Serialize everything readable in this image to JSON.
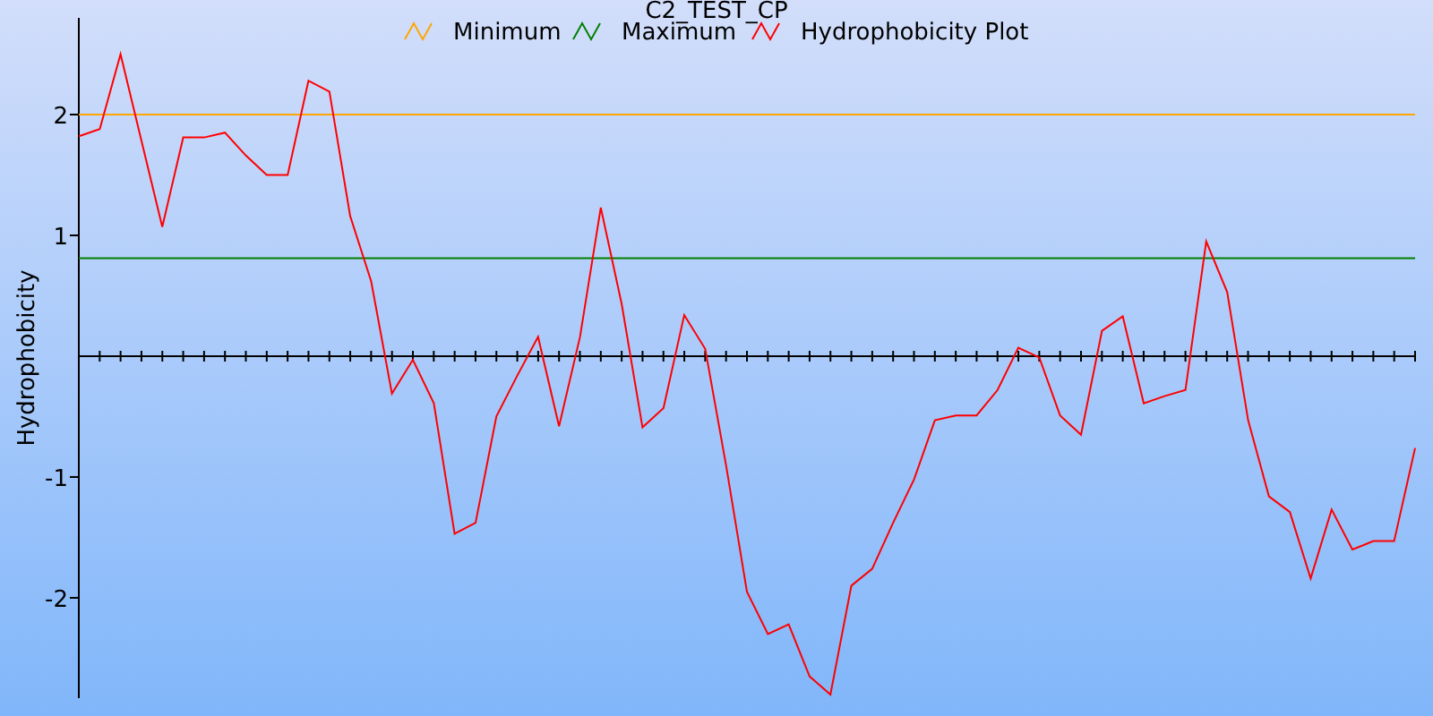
{
  "chart_data": {
    "type": "line",
    "title": "C2_TEST_CP",
    "ylabel": "Hydrophobicity",
    "ylim": [
      -2.83,
      2.8
    ],
    "yticks": [
      -2,
      -1,
      1,
      2
    ],
    "legend": true,
    "series": [
      {
        "name": "Minimum",
        "color": "#ffa500",
        "values": [
          2,
          2,
          2,
          2,
          2,
          2,
          2,
          2,
          2,
          2,
          2,
          2,
          2,
          2,
          2,
          2,
          2,
          2,
          2,
          2,
          2,
          2,
          2,
          2,
          2,
          2,
          2,
          2,
          2,
          2,
          2,
          2,
          2,
          2,
          2,
          2,
          2,
          2,
          2,
          2,
          2,
          2,
          2,
          2,
          2,
          2,
          2,
          2,
          2,
          2,
          2,
          2,
          2,
          2,
          2,
          2,
          2,
          2,
          2,
          2,
          2,
          2,
          2,
          2,
          2
        ]
      },
      {
        "name": "Maximum",
        "color": "#008000",
        "values": [
          0.81,
          0.81,
          0.81,
          0.81,
          0.81,
          0.81,
          0.81,
          0.81,
          0.81,
          0.81,
          0.81,
          0.81,
          0.81,
          0.81,
          0.81,
          0.81,
          0.81,
          0.81,
          0.81,
          0.81,
          0.81,
          0.81,
          0.81,
          0.81,
          0.81,
          0.81,
          0.81,
          0.81,
          0.81,
          0.81,
          0.81,
          0.81,
          0.81,
          0.81,
          0.81,
          0.81,
          0.81,
          0.81,
          0.81,
          0.81,
          0.81,
          0.81,
          0.81,
          0.81,
          0.81,
          0.81,
          0.81,
          0.81,
          0.81,
          0.81,
          0.81,
          0.81,
          0.81,
          0.81,
          0.81,
          0.81,
          0.81,
          0.81,
          0.81,
          0.81,
          0.81,
          0.81,
          0.81,
          0.81,
          0.81
        ]
      },
      {
        "name": "Hydrophobicity Plot",
        "color": "#ff0000",
        "values": [
          1.82,
          1.88,
          2.5,
          1.78,
          1.07,
          1.81,
          1.81,
          1.85,
          1.66,
          1.5,
          1.5,
          2.28,
          2.19,
          1.16,
          0.62,
          -0.31,
          -0.03,
          -0.39,
          -1.47,
          -1.38,
          -0.5,
          -0.16,
          0.16,
          -0.58,
          0.16,
          1.23,
          0.43,
          -0.59,
          -0.43,
          0.34,
          0.06,
          -0.9,
          -1.95,
          -2.3,
          -2.22,
          -2.65,
          -2.8,
          -1.9,
          -1.76,
          -1.38,
          -1.02,
          -0.53,
          -0.49,
          -0.49,
          -0.28,
          0.07,
          -0.01,
          -0.49,
          -0.65,
          0.21,
          0.33,
          -0.39,
          -0.33,
          -0.28,
          0.95,
          0.53,
          -0.53,
          -1.16,
          -1.29,
          -1.84,
          -1.27,
          -1.6,
          -1.53,
          -1.53,
          -0.76
        ]
      }
    ]
  }
}
